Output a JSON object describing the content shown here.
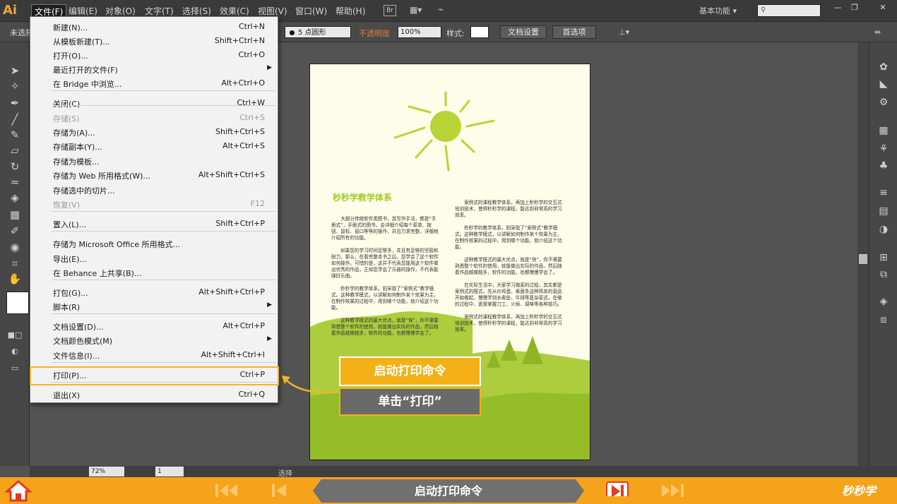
{
  "app": {
    "logo": "Ai"
  },
  "menubar": {
    "items": [
      "文件(F)",
      "编辑(E)",
      "对象(O)",
      "文字(T)",
      "选择(S)",
      "效果(C)",
      "视图(V)",
      "窗口(W)",
      "帮助(H)"
    ],
    "bridge_label": "Br",
    "workspace": "基本功能",
    "window_buttons": [
      "—",
      "❐",
      "✕"
    ]
  },
  "controlbar": {
    "selection_state": "未选择",
    "brush": "5 点圆形",
    "opacity_label": "不透明度",
    "opacity_value": "100%",
    "style_label": "样式:",
    "doc_setup_button": "文档设置",
    "preferences_button": "首选项"
  },
  "file_menu": {
    "items": [
      {
        "label": "新建(N)...",
        "shortcut": "Ctrl+N"
      },
      {
        "label": "从模板新建(T)...",
        "shortcut": "Shift+Ctrl+N"
      },
      {
        "label": "打开(O)...",
        "shortcut": "Ctrl+O"
      },
      {
        "label": "最近打开的文件(F)",
        "shortcut": "",
        "submenu": true
      },
      {
        "label": "在 Bridge 中浏览...",
        "shortcut": "Alt+Ctrl+O"
      },
      {
        "label": "关闭(C)",
        "shortcut": "Ctrl+W"
      },
      {
        "label": "存储(S)",
        "shortcut": "Ctrl+S",
        "disabled": true
      },
      {
        "label": "存储为(A)...",
        "shortcut": "Shift+Ctrl+S"
      },
      {
        "label": "存储副本(Y)...",
        "shortcut": "Alt+Ctrl+S"
      },
      {
        "label": "存储为模板...",
        "shortcut": ""
      },
      {
        "label": "存储为 Web 所用格式(W)...",
        "shortcut": "Alt+Shift+Ctrl+S"
      },
      {
        "label": "存储选中的切片...",
        "shortcut": ""
      },
      {
        "label": "恢复(V)",
        "shortcut": "F12",
        "disabled": true
      },
      {
        "label": "置入(L)...",
        "shortcut": "Shift+Ctrl+P"
      },
      {
        "label": "存储为 Microsoft Office 所用格式...",
        "shortcut": ""
      },
      {
        "label": "导出(E)...",
        "shortcut": ""
      },
      {
        "label": "在 Behance 上共享(B)...",
        "shortcut": ""
      },
      {
        "label": "打包(G)...",
        "shortcut": "Alt+Shift+Ctrl+P"
      },
      {
        "label": "脚本(R)",
        "shortcut": "",
        "submenu": true
      },
      {
        "label": "文档设置(D)...",
        "shortcut": "Alt+Ctrl+P"
      },
      {
        "label": "文档颜色模式(M)",
        "shortcut": "",
        "submenu": true
      },
      {
        "label": "文件信息(I)...",
        "shortcut": "Alt+Shift+Ctrl+I"
      },
      {
        "label": "打印(P)...",
        "shortcut": "Ctrl+P",
        "highlighted": true
      },
      {
        "label": "退出(X)",
        "shortcut": "Ctrl+Q"
      }
    ]
  },
  "document": {
    "title": "秒秒学教学体系",
    "col_left": [
      "大部分传统软件类图书，其写作手法，都是“手册式”，手册式的图书，会详细介绍每个菜单、按钮、鼠标、窗口等等的操作，并且力求完整，详细地介绍所有的功能。",
      "如果您的学习时间足够多，并且有足够的坚毅和耐力，那么，在看完整本书之后，您学会了这个软件如何操作。可惜的是，这并不代表您能用这个软件做出优秀的作品，正如您学会了乐器的操作，不代表能弹好乐曲。",
      "秒秒学的教学体系，则采取了“案例式”教学模式。这种教学模式，以讲解如何制作某个效果为主，在制作效果的过程中，用到哪个功能，就介绍这个功能。",
      "这种教学模式的最大优点，就是“快”，你不需要熟悉整个软件的使用，就能做出实际的作品，然后随着作品越做越多，软件的功能，也都慢慢学会了。"
    ],
    "col_right": [
      "案例式的课程教学体系，再加上秒秒学的交互式培训技术，使得秒秒学的课程，能达到非常高的学习效率。",
      "秒秒学的教学体系，则采取了“案例式”教学模式。这种教学模式，以讲解如何制作某个效果为主，在制作效果的过程中，用到哪个功能，就介绍这个功能。",
      "这种教学模式的最大优点，就是“快”，你不需要熟悉整个软件的使用，就能做出实际的作品，然后随着作品越做越多，软件的功能，也都慢慢学会了。",
      "在实际生活中，大家学习做菜的过程，其实都是案例式的模式，先从炒鸡蛋、煮面条这种简单的菜品开始做起，慢慢学到水煮鱼、牛排等复杂菜式，在做的过程中，逐渐掌握刀工、火候、调味等各种技巧。",
      "案例式的课程教学体系，再加上秒秒学的交互式培训技术，使得秒秒学的课程，能达到非常高的学习效率。"
    ]
  },
  "statusbar": {
    "zoom": "72%",
    "page": "1",
    "tool_name": "选择"
  },
  "callouts": {
    "primary": "启动打印命令",
    "secondary": "单击“打印”"
  },
  "player": {
    "step_title": "启动打印命令",
    "brand": "秒秒学"
  },
  "colors": {
    "accent": "#f6a31c",
    "highlight": "#f2b52a",
    "leaf_green": "#a6c92f"
  }
}
